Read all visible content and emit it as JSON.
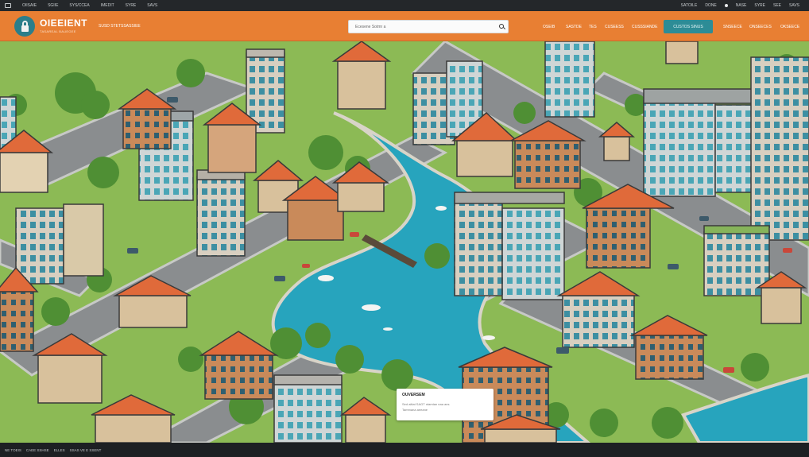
{
  "sysbar": {
    "items": [
      "OIISAIE",
      "SGIIE",
      "SYS/CCEA",
      "IMEDIT",
      "SYRE",
      "SAVS"
    ],
    "right_items": [
      "SATOILE",
      "DONE",
      "NASE",
      "SYRE",
      "SEE",
      "SAVS"
    ]
  },
  "header": {
    "brand_title": "OIEEIENT",
    "brand_sub": "TASAREAL BAUEGEE",
    "link": "SUSD STET",
    "link2": "SSASSIEE",
    "search_placeholder": "Ecesene Sotmr a",
    "nav": [
      "OSEIB",
      "SASTDE",
      "TES",
      "CUSEESS",
      "CUSSSIANDE"
    ],
    "cta_label": "CUSTOS SINUS",
    "nav_right": [
      "SNSEECE",
      "ONSEECES",
      "OKSEECE"
    ]
  },
  "card": {
    "title": "OUVERSEM",
    "line1": "Sed aitiat SAGT ntamtan naa ans",
    "line2": "Tammana aeeane"
  },
  "footer": {
    "items": [
      "NE TOEIS",
      "CAEE SSHSE",
      "ELLES",
      "SSAS  VE E SSENT"
    ]
  },
  "colors": {
    "header": "#e87f33",
    "accent": "#2d8c96",
    "water": "#27a4bd",
    "roof": "#e06a3a",
    "grass": "#78b04a"
  }
}
